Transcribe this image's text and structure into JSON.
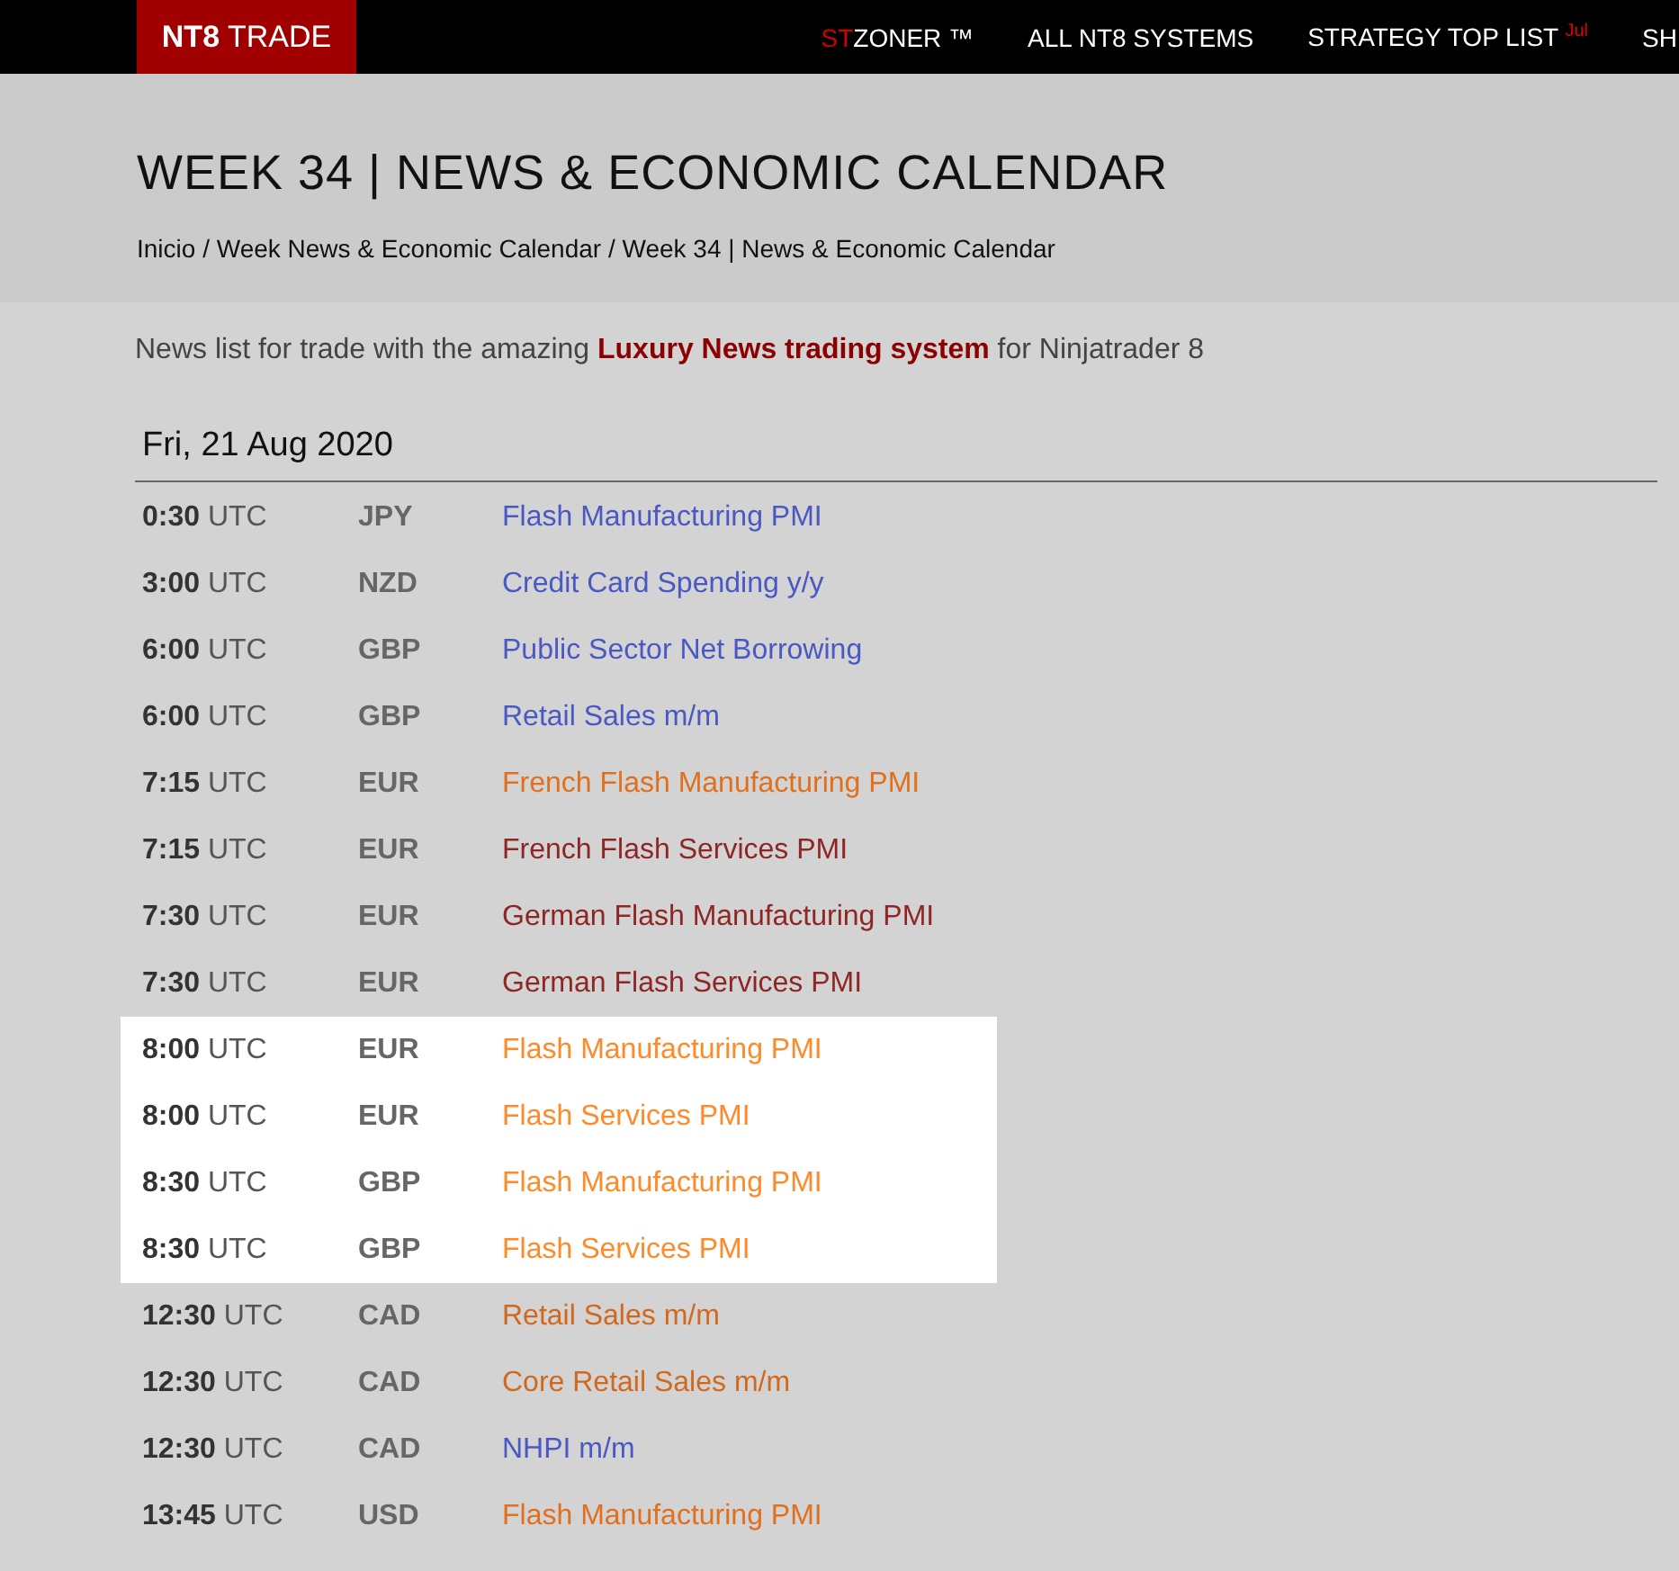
{
  "logo": "**NT8** TRADE",
  "nav": [
    {
      "accent": "ST",
      "label": "ZONER ™"
    },
    {
      "label": "ALL NT8 SYSTEMS"
    },
    {
      "label": "STRATEGY TOP LIST $^{Jul}$"
    },
    {
      "label": "SH"
    }
  ],
  "page_title": "WEEK 34 | NEWS & ECONOMIC CALENDAR",
  "breadcrumb": "Inicio / Week News & Economic Calendar / Week 34 | News & Economic Calendar",
  "intro": "News list for trade with the amazing **Luxury News trading system** for Ninjatrader 8",
  "day": "Fri, 21 Aug 2020",
  "events": [
    {
      "time": "**0:30** UTC",
      "currency": "JPY",
      "event": "Flash Manufacturing PMI",
      "color": "#4a58c4",
      "highlighted": false
    },
    {
      "time": "**3:00** UTC",
      "currency": "NZD",
      "event": "Credit Card Spending y/y",
      "color": "#4a58c4",
      "highlighted": false
    },
    {
      "time": "**6:00** UTC",
      "currency": "GBP",
      "event": "Public Sector Net Borrowing",
      "color": "#4a58c4",
      "highlighted": false
    },
    {
      "time": "**6:00** UTC",
      "currency": "GBP",
      "event": "Retail Sales m/m",
      "color": "#4a58c4",
      "highlighted": false
    },
    {
      "time": "**7:15** UTC",
      "currency": "EUR",
      "event": "French Flash Manufacturing PMI",
      "color": "#e0701e",
      "highlighted": false
    },
    {
      "time": "**7:15** UTC",
      "currency": "EUR",
      "event": "French Flash Services PMI",
      "color": "#8e2626",
      "highlighted": false
    },
    {
      "time": "**7:30** UTC",
      "currency": "EUR",
      "event": "German Flash Manufacturing PMI",
      "color": "#8e2626",
      "highlighted": false
    },
    {
      "time": "**7:30** UTC",
      "currency": "EUR",
      "event": "German Flash Services PMI",
      "color": "#8e2626",
      "highlighted": false
    },
    {
      "time": "**8:00** UTC",
      "currency": "EUR",
      "event": "Flash Manufacturing PMI",
      "color": "#ff8a2a",
      "highlighted": true
    },
    {
      "time": "**8:00** UTC",
      "currency": "EUR",
      "event": "Flash Services PMI",
      "color": "#ff8a2a",
      "highlighted": true
    },
    {
      "time": "**8:30** UTC",
      "currency": "GBP",
      "event": "Flash Manufacturing PMI",
      "color": "#ff8a2a",
      "highlighted": true
    },
    {
      "time": "**8:30** UTC",
      "currency": "GBP",
      "event": "Flash Services PMI",
      "color": "#ff8a2a",
      "highlighted": true
    },
    {
      "time": "**12:30** UTC",
      "currency": "CAD",
      "event": "Retail Sales m/m",
      "color": "#d0681e",
      "highlighted": false
    },
    {
      "time": "**12:30** UTC",
      "currency": "CAD",
      "event": "Core Retail Sales m/m",
      "color": "#d0681e",
      "highlighted": false
    },
    {
      "time": "**12:30** UTC",
      "currency": "CAD",
      "event": "NHPI m/m",
      "color": "#4a58c4",
      "highlighted": false
    },
    {
      "time": "**13:45** UTC",
      "currency": "USD",
      "event": "Flash Manufacturing PMI",
      "color": "#e0701e",
      "highlighted": false
    }
  ]
}
